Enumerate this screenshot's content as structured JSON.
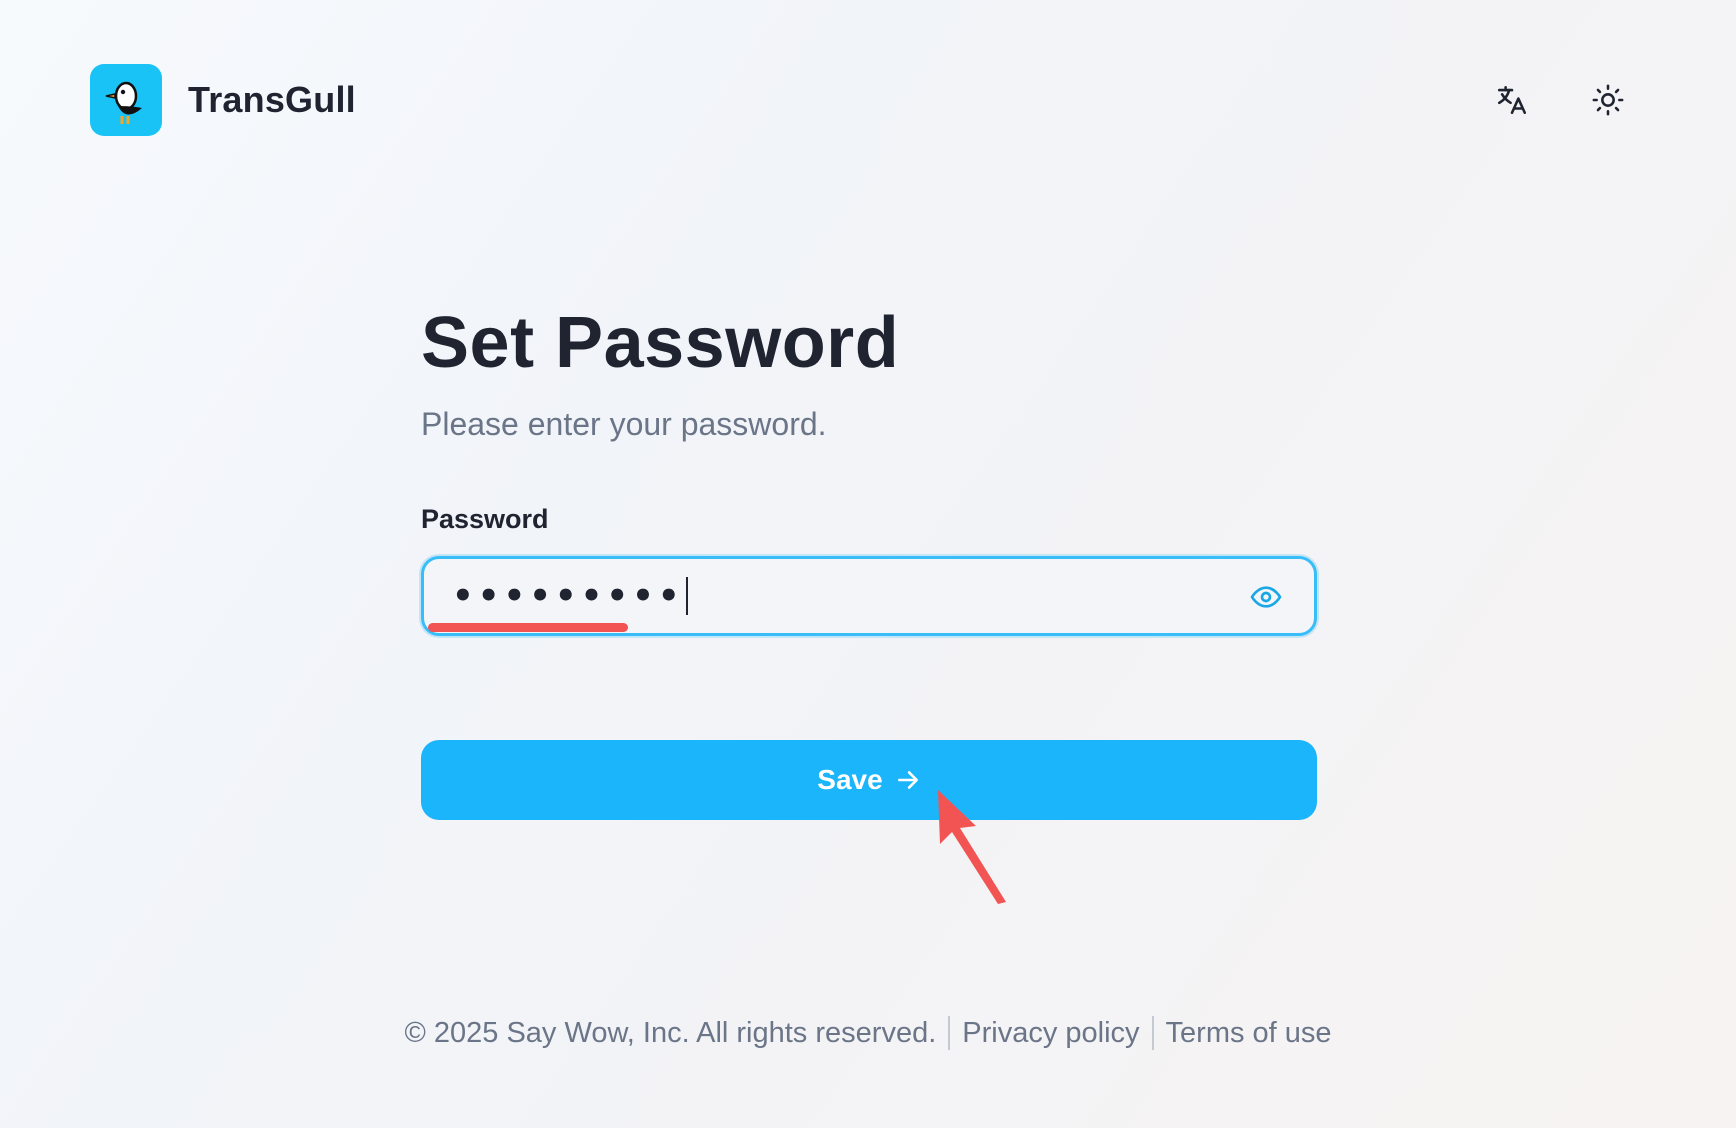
{
  "app": {
    "name": "TransGull",
    "logo_icon": "seagull-logo-icon",
    "brand_color": "#19c3f5"
  },
  "header": {
    "translate_icon": "translate-icon",
    "theme_icon": "sun-icon"
  },
  "form": {
    "title": "Set Password",
    "subtitle": "Please enter your password.",
    "password_label": "Password",
    "password_value": "•••••••••",
    "reveal_icon": "eye-icon",
    "focus_color": "#38bdf8"
  },
  "save_button": {
    "label": "Save",
    "icon": "arrow-right-icon",
    "color": "#1bb5fb"
  },
  "annotation": {
    "pointer_icon": "red-pointer-arrow-icon",
    "highlight_color": "#f25454"
  },
  "footer": {
    "copyright": "© 2025 Say Wow, Inc. All rights reserved.",
    "privacy": "Privacy policy",
    "terms": "Terms of use"
  }
}
